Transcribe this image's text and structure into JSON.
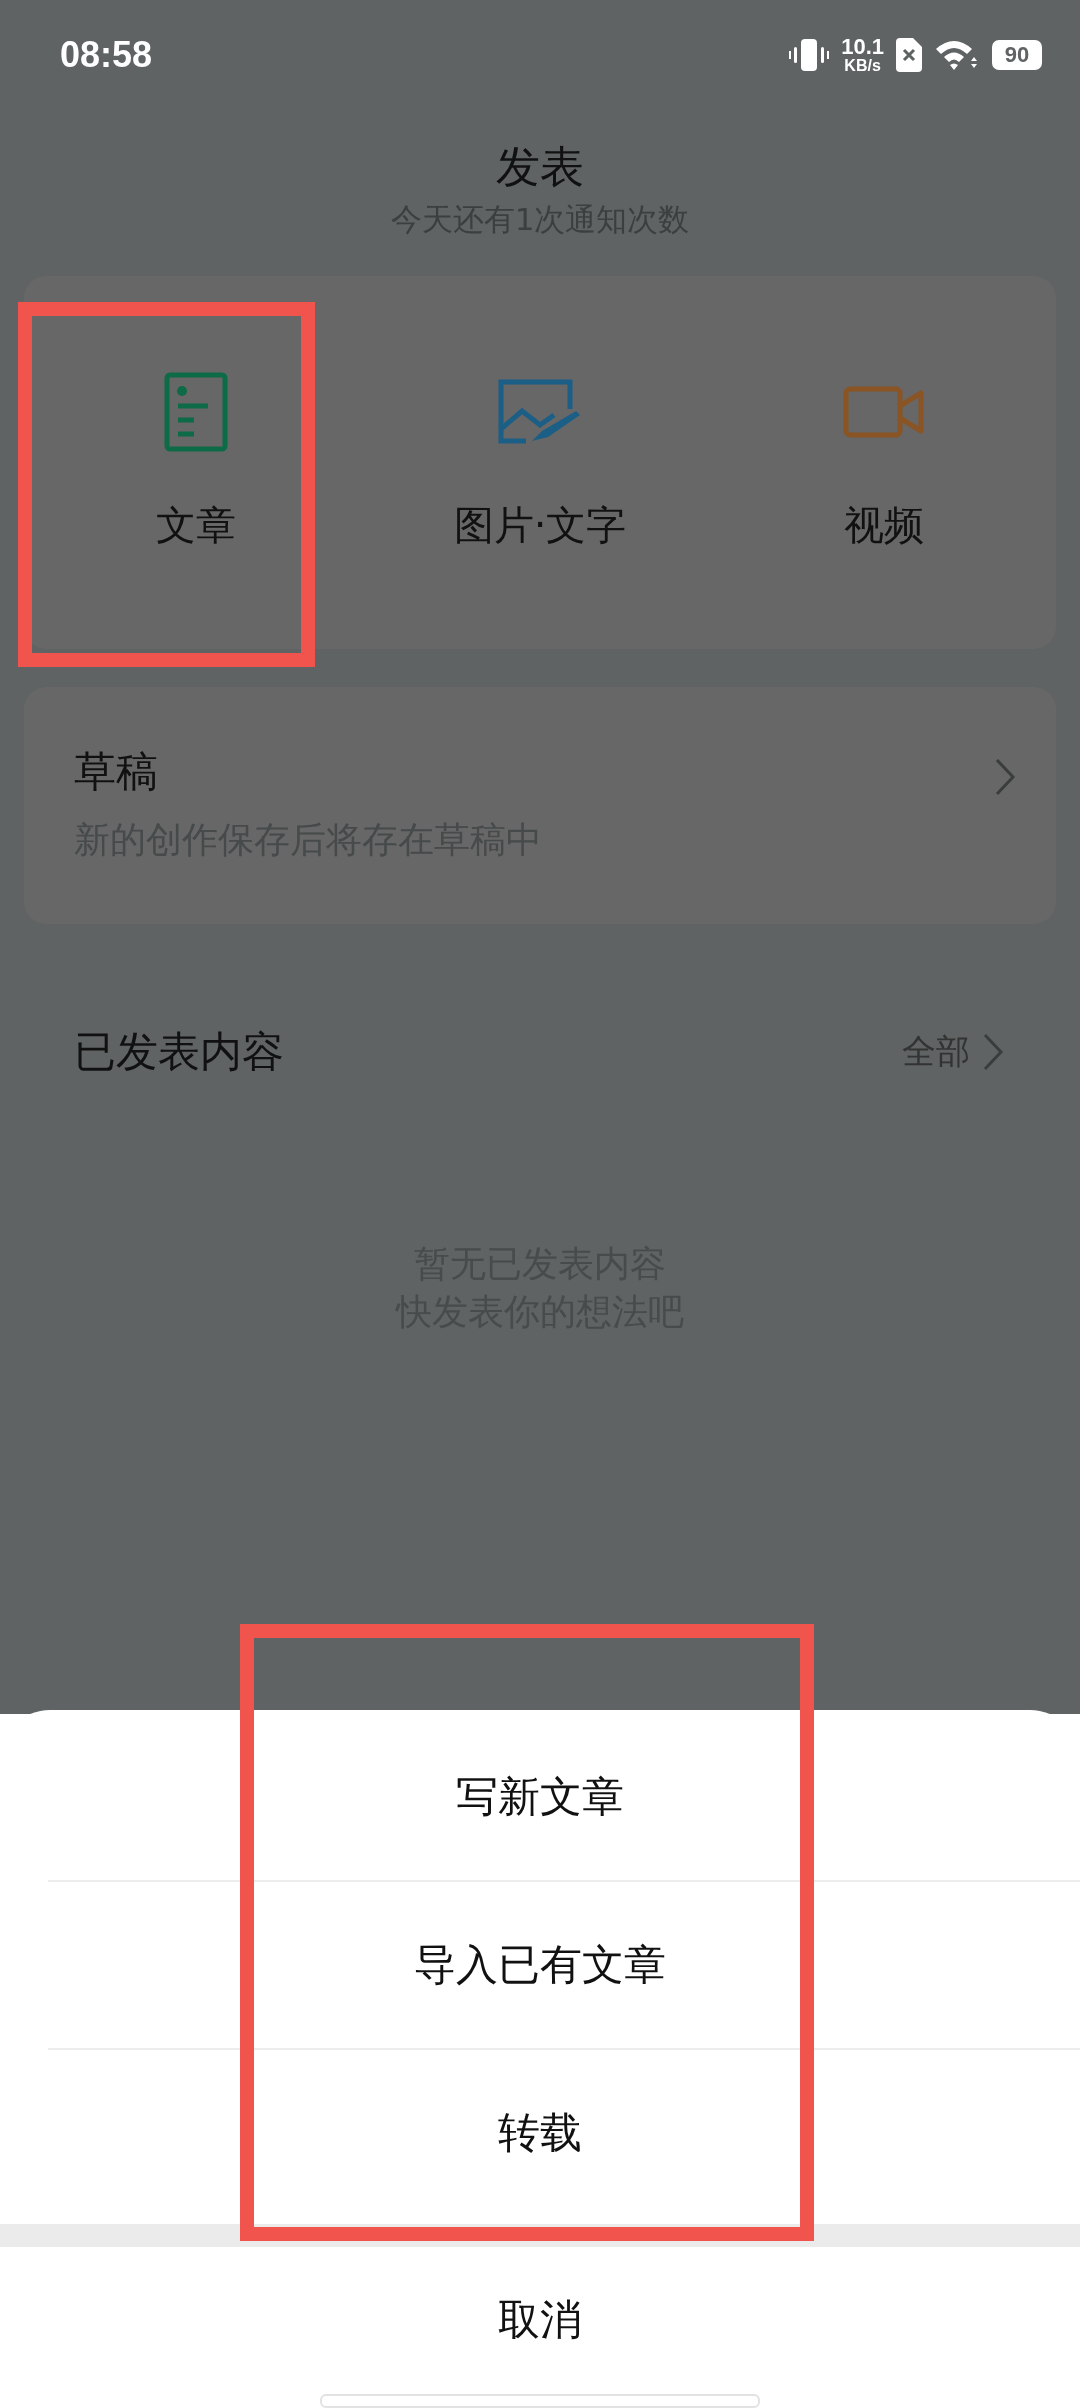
{
  "status_bar": {
    "time": "08:58",
    "net_speed_value": "10.1",
    "net_speed_unit": "KB/s",
    "battery": "90"
  },
  "header": {
    "title": "发表",
    "subtitle": "今天还有1次通知次数"
  },
  "post_types": [
    {
      "kind": "article",
      "label": "文章",
      "color": "#0e6b47",
      "highlighted": true
    },
    {
      "kind": "image",
      "label": "图片·文字",
      "color": "#1c5f86",
      "highlighted": false
    },
    {
      "kind": "video",
      "label": "视频",
      "color": "#8a5424",
      "highlighted": false
    }
  ],
  "drafts": {
    "title": "草稿",
    "subtitle": "新的创作保存后将存在草稿中"
  },
  "published": {
    "title": "已发表内容",
    "link": "全部",
    "empty_lines": [
      "暂无已发表内容",
      "快发表你的想法吧"
    ]
  },
  "sheet": {
    "options_highlighted": true,
    "options": [
      "写新文章",
      "导入已有文章",
      "转载"
    ],
    "cancel": "取消"
  }
}
